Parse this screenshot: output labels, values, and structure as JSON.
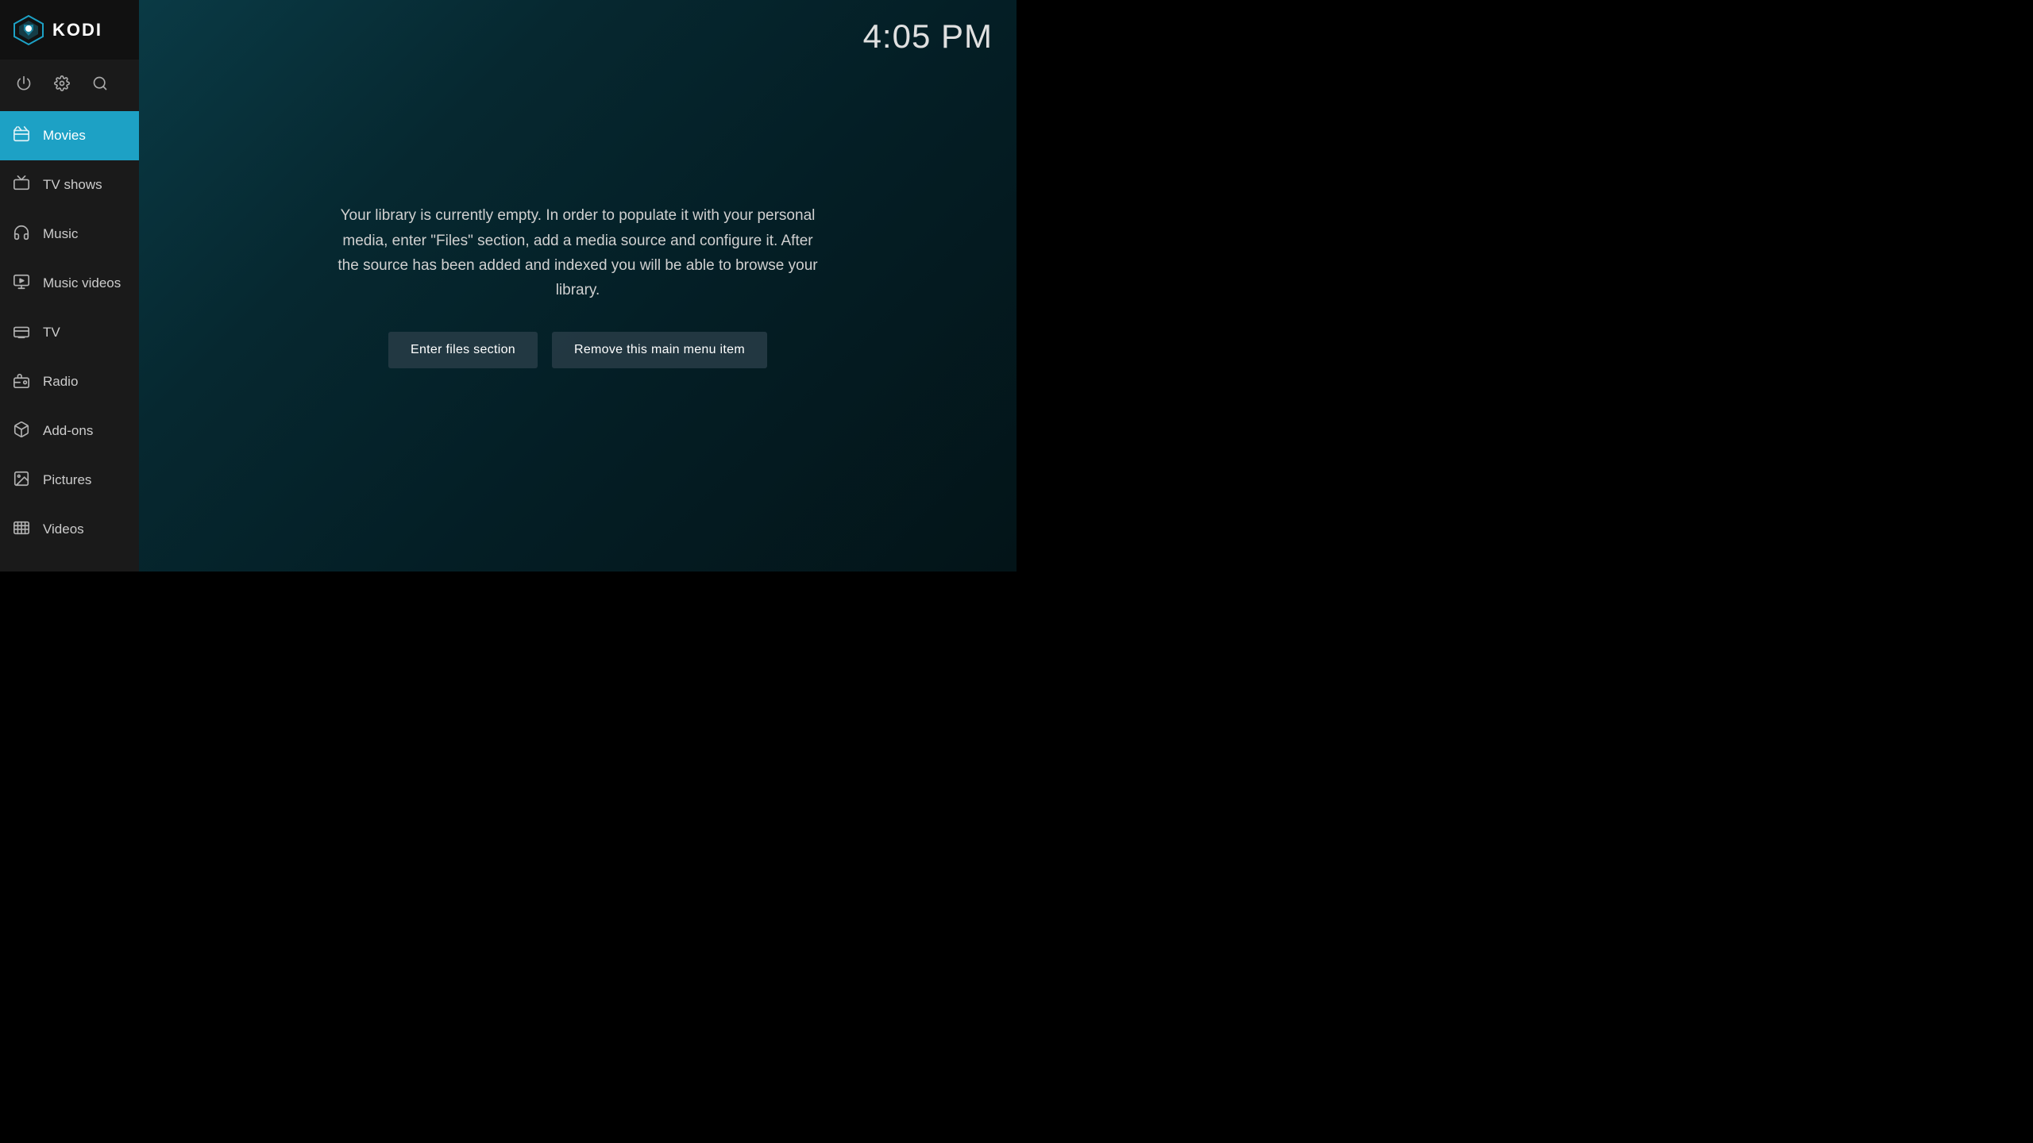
{
  "header": {
    "logo_text": "KODI",
    "clock": "4:05 PM"
  },
  "controls": [
    {
      "name": "power-icon",
      "symbol": "⏻"
    },
    {
      "name": "settings-icon",
      "symbol": "⚙"
    },
    {
      "name": "search-icon",
      "symbol": "🔍"
    }
  ],
  "nav": {
    "items": [
      {
        "id": "movies",
        "label": "Movies",
        "icon": "🎬",
        "active": true
      },
      {
        "id": "tv-shows",
        "label": "TV shows",
        "icon": "🖥",
        "active": false
      },
      {
        "id": "music",
        "label": "Music",
        "icon": "🎧",
        "active": false
      },
      {
        "id": "music-videos",
        "label": "Music videos",
        "icon": "🎞",
        "active": false
      },
      {
        "id": "tv",
        "label": "TV",
        "icon": "📺",
        "active": false
      },
      {
        "id": "radio",
        "label": "Radio",
        "icon": "📻",
        "active": false
      },
      {
        "id": "add-ons",
        "label": "Add-ons",
        "icon": "📦",
        "active": false
      },
      {
        "id": "pictures",
        "label": "Pictures",
        "icon": "🖼",
        "active": false
      },
      {
        "id": "videos",
        "label": "Videos",
        "icon": "🎥",
        "active": false
      }
    ]
  },
  "main": {
    "empty_message": "Your library is currently empty. In order to populate it with your personal media, enter \"Files\" section, add a media source and configure it. After the source has been added and indexed you will be able to browse your library.",
    "buttons": {
      "enter_files": "Enter files section",
      "remove_item": "Remove this main menu item"
    }
  }
}
